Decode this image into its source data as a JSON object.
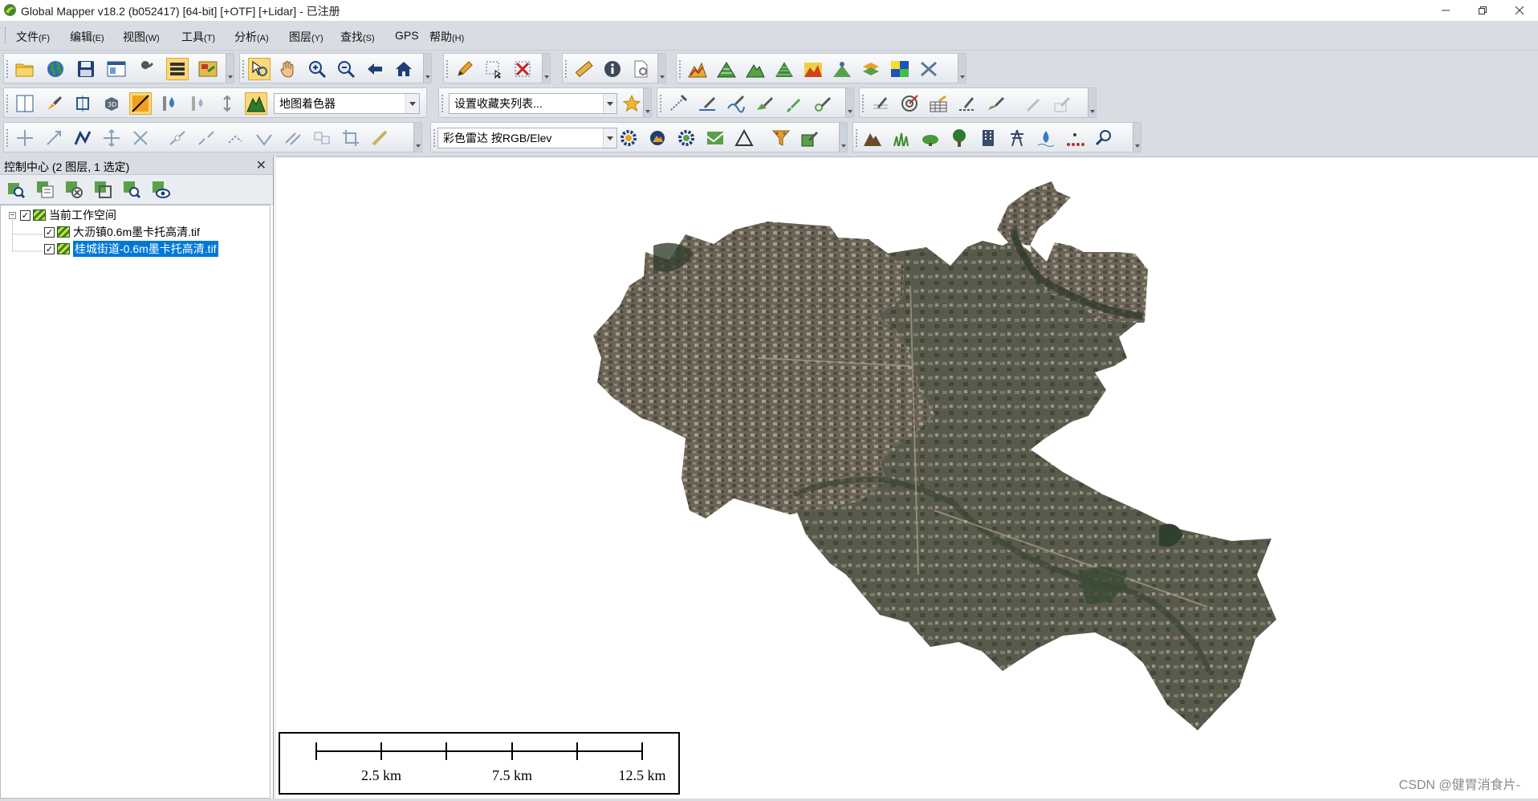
{
  "window": {
    "title": "Global Mapper v18.2 (b052417) [64-bit] [+OTF] [+Lidar] - 已注册",
    "minimize_icon": "minimize-icon",
    "restore_icon": "restore-icon",
    "close_icon": "close-icon"
  },
  "menu": [
    {
      "label": "文件",
      "key": "(F)"
    },
    {
      "label": "编辑",
      "key": "(E)"
    },
    {
      "label": "视图",
      "key": "(W)"
    },
    {
      "label": "工具",
      "key": "(T)"
    },
    {
      "label": "分析",
      "key": "(A)"
    },
    {
      "label": "图层",
      "key": "(Y)"
    },
    {
      "label": "查找",
      "key": "(S)"
    },
    {
      "label": "GPS",
      "key": ""
    },
    {
      "label": "帮助",
      "key": "(H)"
    }
  ],
  "toolbars": {
    "shader_combo": "地图着色器",
    "favorites_combo": "设置收藏夹列表...",
    "lidar_color_combo": "彩色雷达 按RGB/Elev"
  },
  "control_center": {
    "title": "控制中心 (2 图层, 1 选定)",
    "close": "✕",
    "workspace": "当前工作空间",
    "layers": [
      {
        "name": "大沥镇0.6m墨卡托高清.tif",
        "checked": true,
        "selected": false
      },
      {
        "name": "桂城街道-0.6m墨卡托高清.tif",
        "checked": true,
        "selected": true
      }
    ]
  },
  "scale_bar": {
    "labels": [
      "2.5 km",
      "7.5 km",
      "12.5 km"
    ]
  },
  "watermark": "CSDN @健胃消食片-",
  "colors": {
    "accent_selected": "#0078d7",
    "toolbar_bg": "#d9dde3",
    "active_button": "#fbd878"
  }
}
